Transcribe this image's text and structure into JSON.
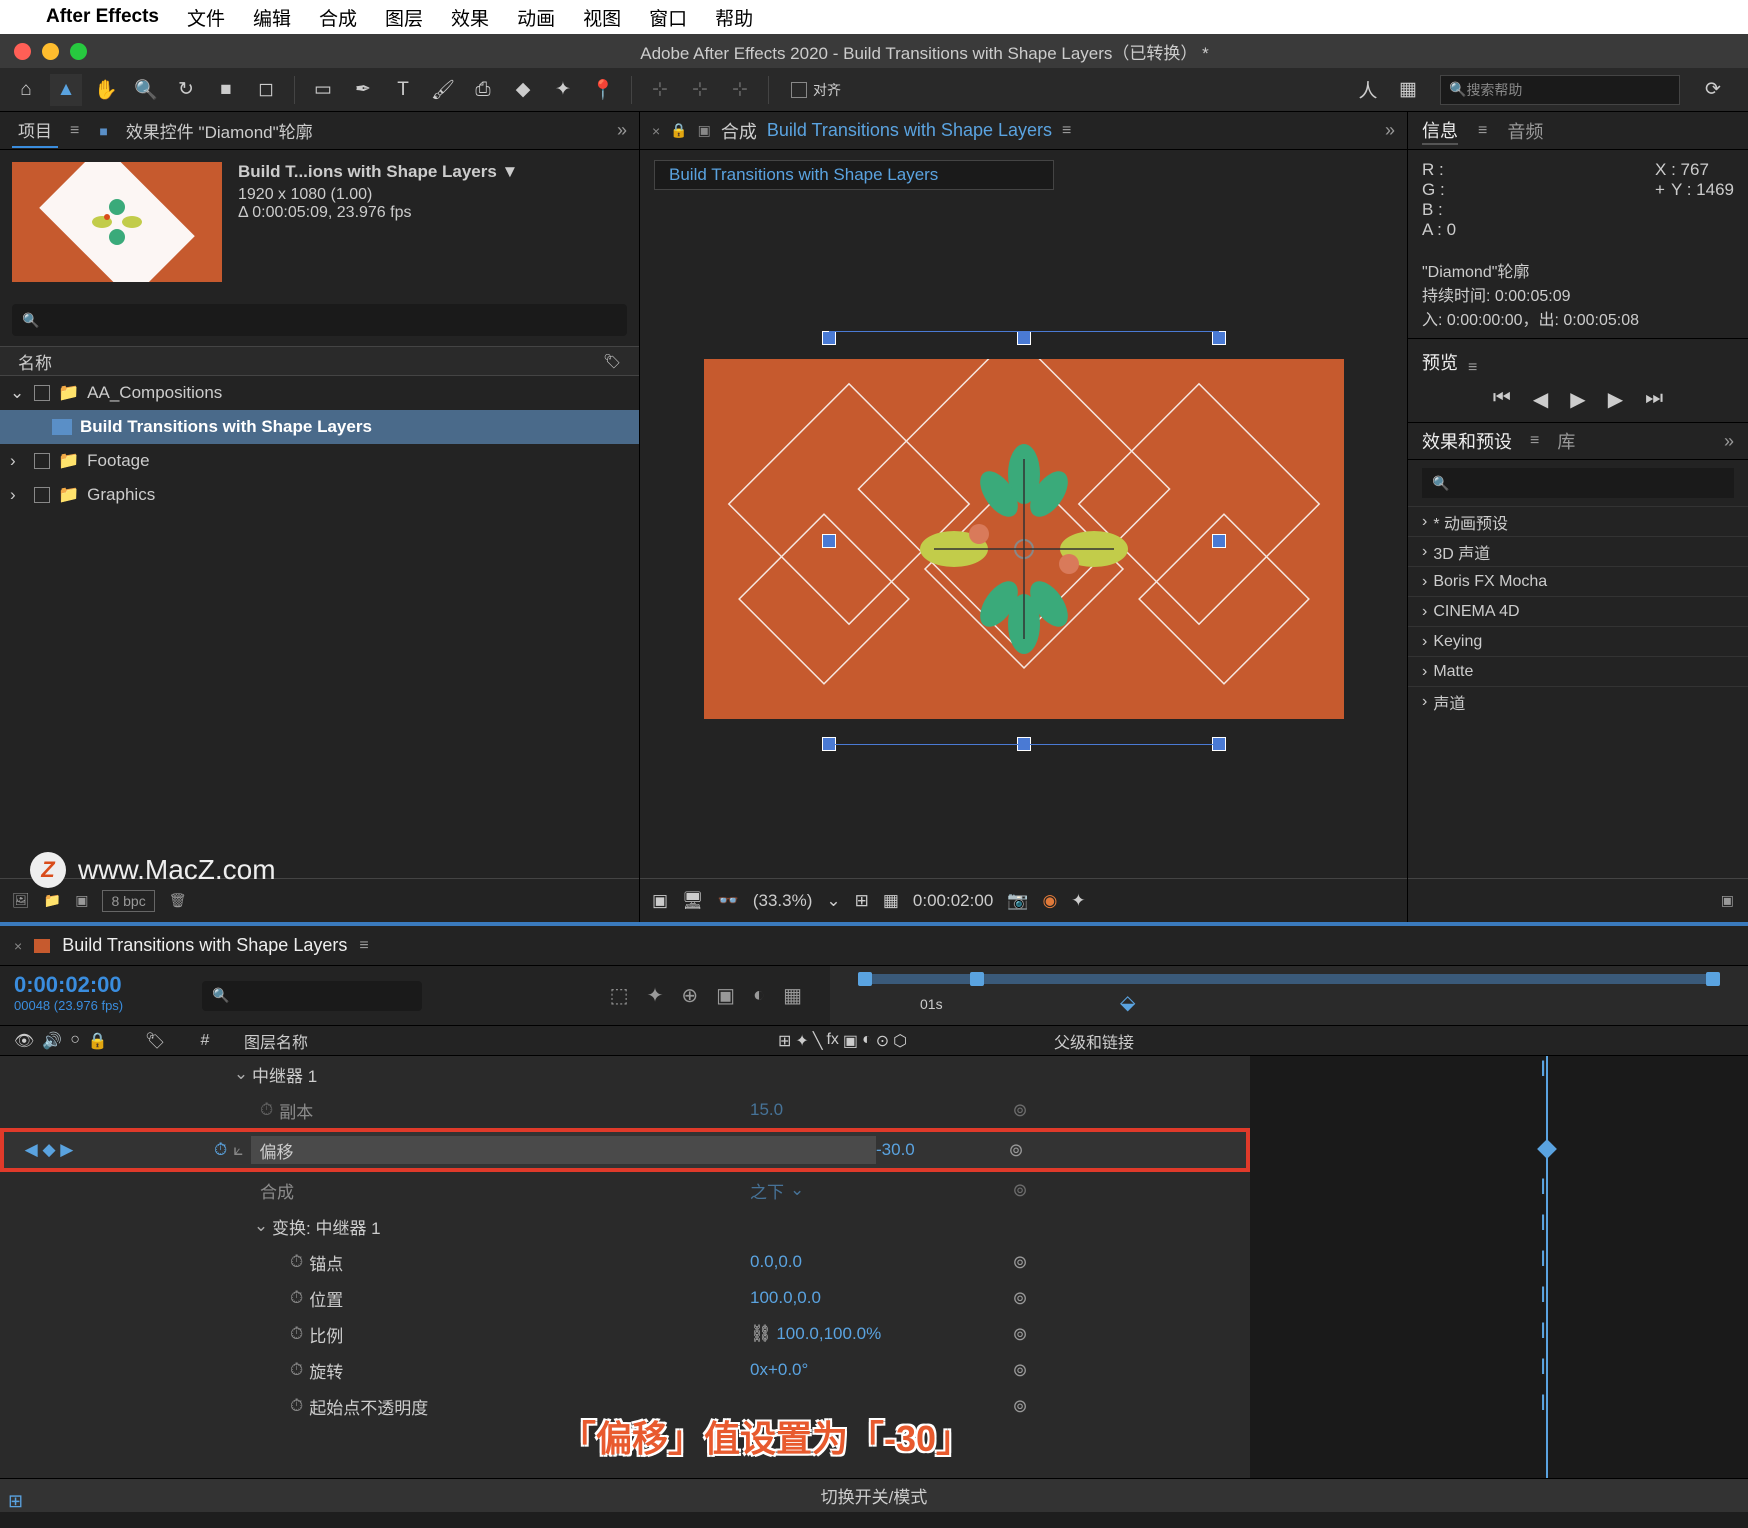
{
  "mac_menu": {
    "app": "After Effects",
    "items": [
      "文件",
      "编辑",
      "合成",
      "图层",
      "效果",
      "动画",
      "视图",
      "窗口",
      "帮助"
    ]
  },
  "titlebar": "Adobe After Effects 2020 - Build Transitions with Shape Layers（已转换） *",
  "toolbar": {
    "align": "对齐",
    "search_placeholder": "搜索帮助"
  },
  "project": {
    "tab_project": "项目",
    "tab_effects": "效果控件 \"Diamond\"轮廓",
    "comp_title": "Build T...ions with Shape Layers ▼",
    "comp_dims": "1920 x 1080 (1.00)",
    "comp_dur": "Δ 0:00:05:09, 23.976 fps",
    "name_header": "名称",
    "items": [
      {
        "type": "folder",
        "name": "AA_Compositions",
        "open": true
      },
      {
        "type": "comp",
        "name": "Build Transitions with Shape Layers",
        "sel": true
      },
      {
        "type": "folder",
        "name": "Footage",
        "open": false
      },
      {
        "type": "folder",
        "name": "Graphics",
        "open": false
      }
    ],
    "watermark": "www.MacZ.com",
    "bpc": "8 bpc"
  },
  "composition": {
    "prefix": "合成",
    "tab": "Build Transitions with Shape Layers",
    "flowchart": "Build Transitions with Shape Layers",
    "zoom": "(33.3%)",
    "time": "0:00:02:00"
  },
  "info": {
    "tab_info": "信息",
    "tab_audio": "音频",
    "r": "R :",
    "g": "G :",
    "b": "B :",
    "a": "A :  0",
    "x": "X : 767",
    "y": "Y : 1469",
    "sel_name": "\"Diamond\"轮廓",
    "sel_dur": "持续时间: 0:00:05:09",
    "sel_inout": "入: 0:00:00:00，出: 0:00:05:08"
  },
  "preview": {
    "title": "预览"
  },
  "effects": {
    "tab_eff": "效果和预设",
    "tab_lib": "库",
    "items": [
      "* 动画预设",
      "3D 声道",
      "Boris FX Mocha",
      "CINEMA 4D",
      "Keying",
      "Matte",
      "声道"
    ]
  },
  "timeline": {
    "comp": "Build Transitions with Shape Layers",
    "timecode": "0:00:02:00",
    "frames": "00048 (23.976 fps)",
    "ruler_label": "01s",
    "col_layer": "图层名称",
    "col_num": "#",
    "col_parent": "父级和链接",
    "rows": [
      {
        "type": "group",
        "indent": 2,
        "name": "中继器 1",
        "arrow": "v"
      },
      {
        "type": "prop",
        "indent": 3,
        "name": "副本",
        "val": "15.0",
        "stopwatch": true,
        "link": true,
        "dim": true
      },
      {
        "type": "prop",
        "indent": 3,
        "name": "偏移",
        "val": "-30.0",
        "stopwatch": true,
        "graph": true,
        "link": true,
        "red": true,
        "kf": true
      },
      {
        "type": "prop",
        "indent": 3,
        "name": "合成",
        "val": "之下",
        "dropdown": true,
        "link": true,
        "dim": true
      },
      {
        "type": "group",
        "indent": 3,
        "name": "变换: 中继器 1",
        "arrow": "v"
      },
      {
        "type": "prop",
        "indent": 4,
        "name": "锚点",
        "val": "0.0,0.0",
        "stopwatch": true,
        "link": true
      },
      {
        "type": "prop",
        "indent": 4,
        "name": "位置",
        "val": "100.0,0.0",
        "stopwatch": true,
        "link": true
      },
      {
        "type": "prop",
        "indent": 4,
        "name": "比例",
        "val": "100.0,100.0%",
        "stopwatch": true,
        "chain": true,
        "link": true
      },
      {
        "type": "prop",
        "indent": 4,
        "name": "旋转",
        "val": "0x+0.0°",
        "stopwatch": true,
        "link": true
      },
      {
        "type": "prop",
        "indent": 4,
        "name": "起始点不透明度",
        "val": "",
        "stopwatch": true,
        "link": true
      }
    ],
    "footer": "切换开关/模式"
  },
  "caption": "「偏移」值设置为「-30」"
}
